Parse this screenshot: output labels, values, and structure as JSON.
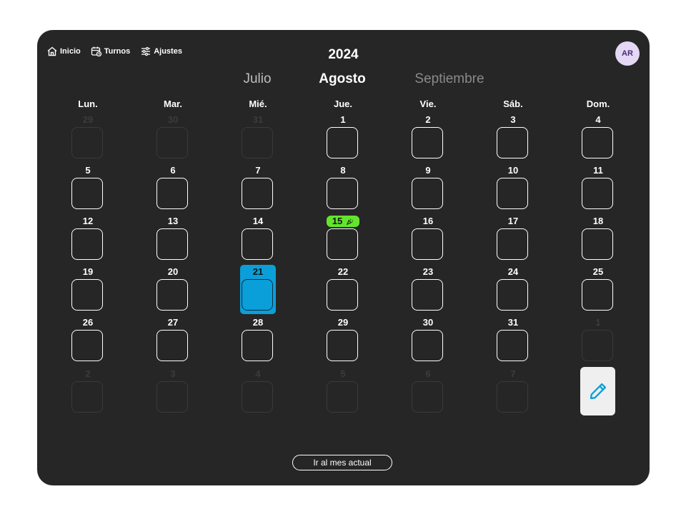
{
  "nav": {
    "home": "Inicio",
    "shifts": "Turnos",
    "settings": "Ajustes"
  },
  "calendar": {
    "year": "2024",
    "prev_month": "Julio",
    "current_month": "Agosto",
    "next_month": "Septiembre",
    "weekdays": [
      "Lun.",
      "Mar.",
      "Mié.",
      "Jue.",
      "Vie.",
      "Sáb.",
      "Dom."
    ],
    "days": [
      {
        "n": "29",
        "out": true
      },
      {
        "n": "30",
        "out": true
      },
      {
        "n": "31",
        "out": true
      },
      {
        "n": "1"
      },
      {
        "n": "2"
      },
      {
        "n": "3"
      },
      {
        "n": "4"
      },
      {
        "n": "5"
      },
      {
        "n": "6"
      },
      {
        "n": "7"
      },
      {
        "n": "8"
      },
      {
        "n": "9"
      },
      {
        "n": "10"
      },
      {
        "n": "11"
      },
      {
        "n": "12"
      },
      {
        "n": "13"
      },
      {
        "n": "14"
      },
      {
        "n": "15",
        "holiday": true
      },
      {
        "n": "16"
      },
      {
        "n": "17"
      },
      {
        "n": "18"
      },
      {
        "n": "19"
      },
      {
        "n": "20"
      },
      {
        "n": "21",
        "today": true
      },
      {
        "n": "22"
      },
      {
        "n": "23"
      },
      {
        "n": "24"
      },
      {
        "n": "25"
      },
      {
        "n": "26"
      },
      {
        "n": "27"
      },
      {
        "n": "28"
      },
      {
        "n": "29"
      },
      {
        "n": "30"
      },
      {
        "n": "31"
      },
      {
        "n": "1",
        "out": true
      },
      {
        "n": "2",
        "out": true
      },
      {
        "n": "3",
        "out": true
      },
      {
        "n": "4",
        "out": true
      },
      {
        "n": "5",
        "out": true
      },
      {
        "n": "6",
        "out": true
      },
      {
        "n": "7",
        "out": true
      }
    ]
  },
  "user": {
    "initials": "AR"
  },
  "actions": {
    "go_current": "Ir al mes actual"
  },
  "icons": {
    "home": "home-icon",
    "shifts": "calendar-clock-icon",
    "settings": "sliders-icon",
    "holiday": "celebration-icon",
    "edit": "pencil-icon"
  },
  "colors": {
    "background": "#262626",
    "today": "#0a9fd9",
    "holiday": "#63e52c",
    "avatar": "#e4d8f5"
  }
}
